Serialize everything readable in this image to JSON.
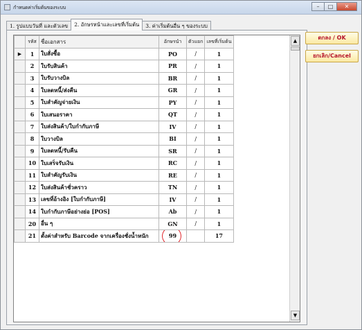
{
  "window": {
    "title": "กำหนดค่าเริ่มต้นของระบบ",
    "buttons": {
      "minimize": "–",
      "maximize": "□",
      "close": "✕"
    }
  },
  "tabs": [
    {
      "label": "1. รูปแบบวันที่ และตัวเลข",
      "active": false
    },
    {
      "label": "2. อักษรหน้าและเลขที่เริ่มต้น",
      "active": true
    },
    {
      "label": "3. ค่าเริ่มต้นอื่น ๆ ของระบบ",
      "active": false
    }
  ],
  "grid": {
    "columns": {
      "no": "รหัส",
      "name": "ชื่อเอกสาร",
      "prefix": "อักษรนำ",
      "separator": "ตัวแยก",
      "start": "เลขที่เริ่มต้น"
    },
    "current_row_marker": "▶",
    "rows": [
      {
        "no": "1",
        "name": "ใบสั่งซื้อ",
        "prefix": "PO",
        "separator": "/",
        "start": "1"
      },
      {
        "no": "2",
        "name": "ใบรับสินค้า",
        "prefix": "PR",
        "separator": "/",
        "start": "1"
      },
      {
        "no": "3",
        "name": "ใบรับวางบิล",
        "prefix": "BR",
        "separator": "/",
        "start": "1"
      },
      {
        "no": "4",
        "name": "ใบลดหนี้/ส่งคืน",
        "prefix": "GR",
        "separator": "/",
        "start": "1"
      },
      {
        "no": "5",
        "name": "ใบสำคัญจ่ายเงิน",
        "prefix": "PY",
        "separator": "/",
        "start": "1"
      },
      {
        "no": "6",
        "name": "ใบเสนอราคา",
        "prefix": "QT",
        "separator": "/",
        "start": "1"
      },
      {
        "no": "7",
        "name": "ใบส่งสินค้า/ใบกำกับภาษี",
        "prefix": "IV",
        "separator": "/",
        "start": "1"
      },
      {
        "no": "8",
        "name": "ใบวางบิล",
        "prefix": "BI",
        "separator": "/",
        "start": "1"
      },
      {
        "no": "9",
        "name": "ใบลดหนี้/รับคืน",
        "prefix": "SR",
        "separator": "/",
        "start": "1"
      },
      {
        "no": "10",
        "name": "ใบเสร็จรับเงิน",
        "prefix": "RC",
        "separator": "/",
        "start": "1"
      },
      {
        "no": "11",
        "name": "ใบสำคัญรับเงิน",
        "prefix": "RE",
        "separator": "/",
        "start": "1"
      },
      {
        "no": "12",
        "name": "ใบส่งสินค้าชั่วคราว",
        "prefix": "TN",
        "separator": "/",
        "start": "1"
      },
      {
        "no": "13",
        "name": "เลขที่อ้างอิง [ใบกำกับภาษี]",
        "prefix": "IV",
        "separator": "/",
        "start": "1"
      },
      {
        "no": "14",
        "name": "ใบกำกับภาษีอย่างย่อ [POS]",
        "prefix": "Ab",
        "separator": "/",
        "start": "1"
      },
      {
        "no": "20",
        "name": "อื่น ๆ",
        "prefix": "GN",
        "separator": "/",
        "start": "1"
      },
      {
        "no": "21",
        "name": "ตั้งค่าสำหรับ Barcode จากเครื่องชั่งน้ำหนัก",
        "prefix": "99",
        "separator": "",
        "start": "17"
      }
    ],
    "scroll": {
      "up": "▲",
      "down": "▼"
    }
  },
  "actions": {
    "ok": "ตกลง / OK",
    "cancel": "ยกเลิก/Cancel"
  },
  "colors": {
    "highlight_ring": "#e1262c",
    "button_text": "#b5122a"
  }
}
